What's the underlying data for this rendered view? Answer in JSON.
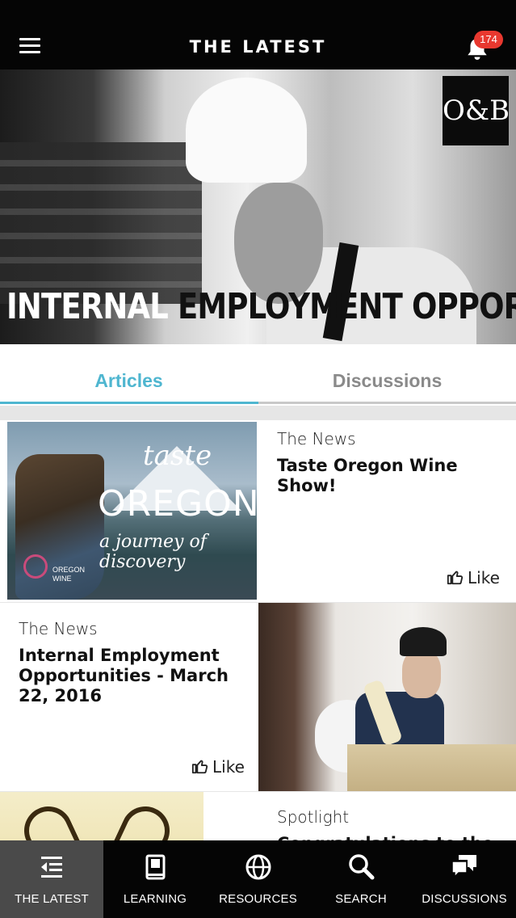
{
  "header": {
    "title": "THE LATEST",
    "notification_count": "174",
    "menu_icon": "hamburger-menu-icon",
    "notification_icon": "bell-icon"
  },
  "hero": {
    "logo_text": "O&B",
    "caption_word1": "INTERNAL",
    "caption_word2": "EMPLOYMENT",
    "caption_word3": "OPPORTUNITIES",
    "slide_count": 2,
    "active_slide": 1
  },
  "tabs": [
    {
      "label": "Articles",
      "active": true
    },
    {
      "label": "Discussions",
      "active": false
    }
  ],
  "feed": {
    "items": [
      {
        "category": "The News",
        "title": "Taste Oregon Wine Show!",
        "like_label": "Like",
        "thumb_text": {
          "taste": "taste",
          "oregon": "OREGON",
          "tagline": "a journey of discovery",
          "brand": "OREGON WINE"
        }
      },
      {
        "category": "The News",
        "title": "Internal Employment Opportunities - March 22, 2016",
        "like_label": "Like"
      },
      {
        "category": "Spotlight",
        "title": "Congratulations to the"
      }
    ]
  },
  "bottom_nav": [
    {
      "label": "THE LATEST",
      "icon": "latest-icon",
      "active": true
    },
    {
      "label": "LEARNING",
      "icon": "book-icon",
      "active": false
    },
    {
      "label": "RESOURCES",
      "icon": "globe-icon",
      "active": false
    },
    {
      "label": "SEARCH",
      "icon": "search-icon",
      "active": false
    },
    {
      "label": "DISCUSSIONS",
      "icon": "chat-bubbles-icon",
      "active": false
    }
  ],
  "colors": {
    "accent": "#4fb6d0",
    "header_bg": "#050505",
    "badge": "#e8382f",
    "nav_active_bg": "#4a4a4a"
  }
}
